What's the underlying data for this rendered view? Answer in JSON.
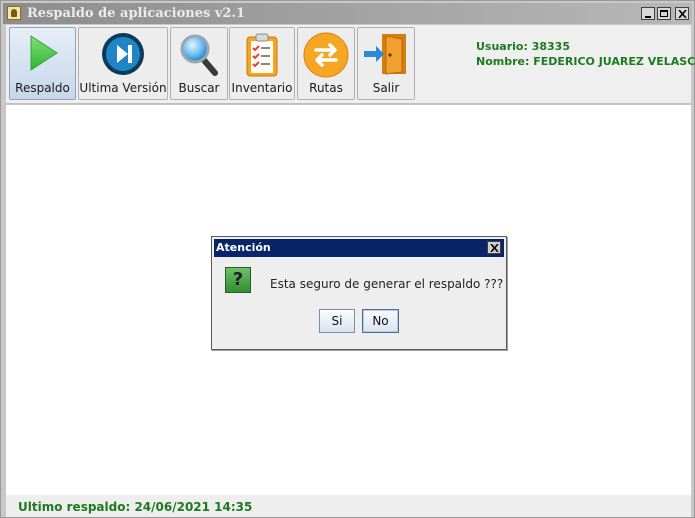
{
  "window": {
    "title": "Respaldo de aplicaciones v2.1"
  },
  "toolbar": {
    "buttons": [
      {
        "label": "Respaldo",
        "icon": "play-icon"
      },
      {
        "label": "Ultima Versión",
        "icon": "next-track-icon"
      },
      {
        "label": "Buscar",
        "icon": "magnifier-icon"
      },
      {
        "label": "Inventario",
        "icon": "clipboard-checklist-icon"
      },
      {
        "label": "Rutas",
        "icon": "swap-arrows-icon"
      },
      {
        "label": "Salir",
        "icon": "exit-door-icon"
      }
    ]
  },
  "user": {
    "usuario_line": "Usuario: 38335",
    "nombre_line": "Nombre: FEDERICO JUAREZ VELASCO"
  },
  "dialog": {
    "title": "Atención",
    "message": "Esta seguro de generar el respaldo ???",
    "yes_label": "Si",
    "no_label": "No",
    "icon": "question-icon"
  },
  "status": {
    "text": "Ultimo respaldo: 24/06/2021 14:35"
  },
  "colors": {
    "accent_green": "#1e7a1e",
    "dialog_title_bg": "#0a246a"
  }
}
